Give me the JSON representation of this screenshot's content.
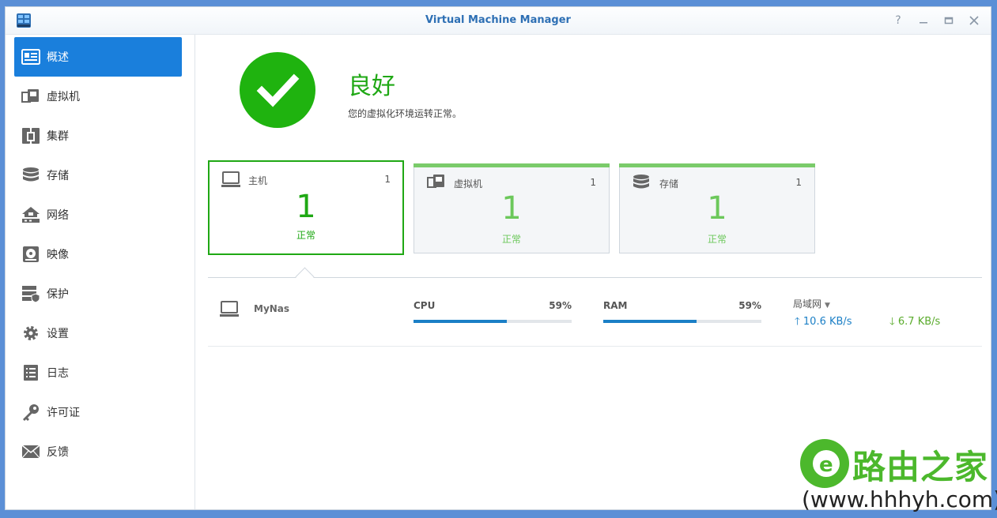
{
  "window": {
    "title": "Virtual Machine Manager"
  },
  "sidebar": {
    "items": [
      {
        "label": "概述",
        "icon": "overview-icon",
        "active": true
      },
      {
        "label": "虚拟机",
        "icon": "virtual-machine-icon"
      },
      {
        "label": "集群",
        "icon": "cluster-icon"
      },
      {
        "label": "存储",
        "icon": "storage-icon"
      },
      {
        "label": "网络",
        "icon": "network-icon"
      },
      {
        "label": "映像",
        "icon": "image-icon"
      },
      {
        "label": "保护",
        "icon": "protection-icon"
      },
      {
        "label": "设置",
        "icon": "gear-icon"
      },
      {
        "label": "日志",
        "icon": "log-icon"
      },
      {
        "label": "许可证",
        "icon": "key-icon"
      },
      {
        "label": "反馈",
        "icon": "mail-icon"
      }
    ]
  },
  "status": {
    "title": "良好",
    "description": "您的虚拟化环境运转正常。",
    "icon": "check-circle-icon",
    "color": "#1fb30f"
  },
  "cards": [
    {
      "name": "主机",
      "count": "1",
      "value": "1",
      "status": "正常",
      "icon": "monitor-icon"
    },
    {
      "name": "虚拟机",
      "count": "1",
      "value": "1",
      "status": "正常",
      "icon": "virtual-machine-icon"
    },
    {
      "name": "存储",
      "count": "1",
      "value": "1",
      "status": "正常",
      "icon": "storage-icon"
    }
  ],
  "host": {
    "name": "MyNas",
    "cpu": {
      "label": "CPU",
      "value": "59%",
      "percent": 59
    },
    "ram": {
      "label": "RAM",
      "value": "59%",
      "percent": 59
    },
    "network": {
      "label": "局域网",
      "upload": "10.6 KB/s",
      "download": "6.7 KB/s"
    }
  },
  "watermark": {
    "title": "路由之家",
    "url": "(www.hhhyh.com)"
  },
  "colors": {
    "accent": "#1a7fdc",
    "ok": "#1fa814",
    "meter": "#1b7fc6"
  }
}
